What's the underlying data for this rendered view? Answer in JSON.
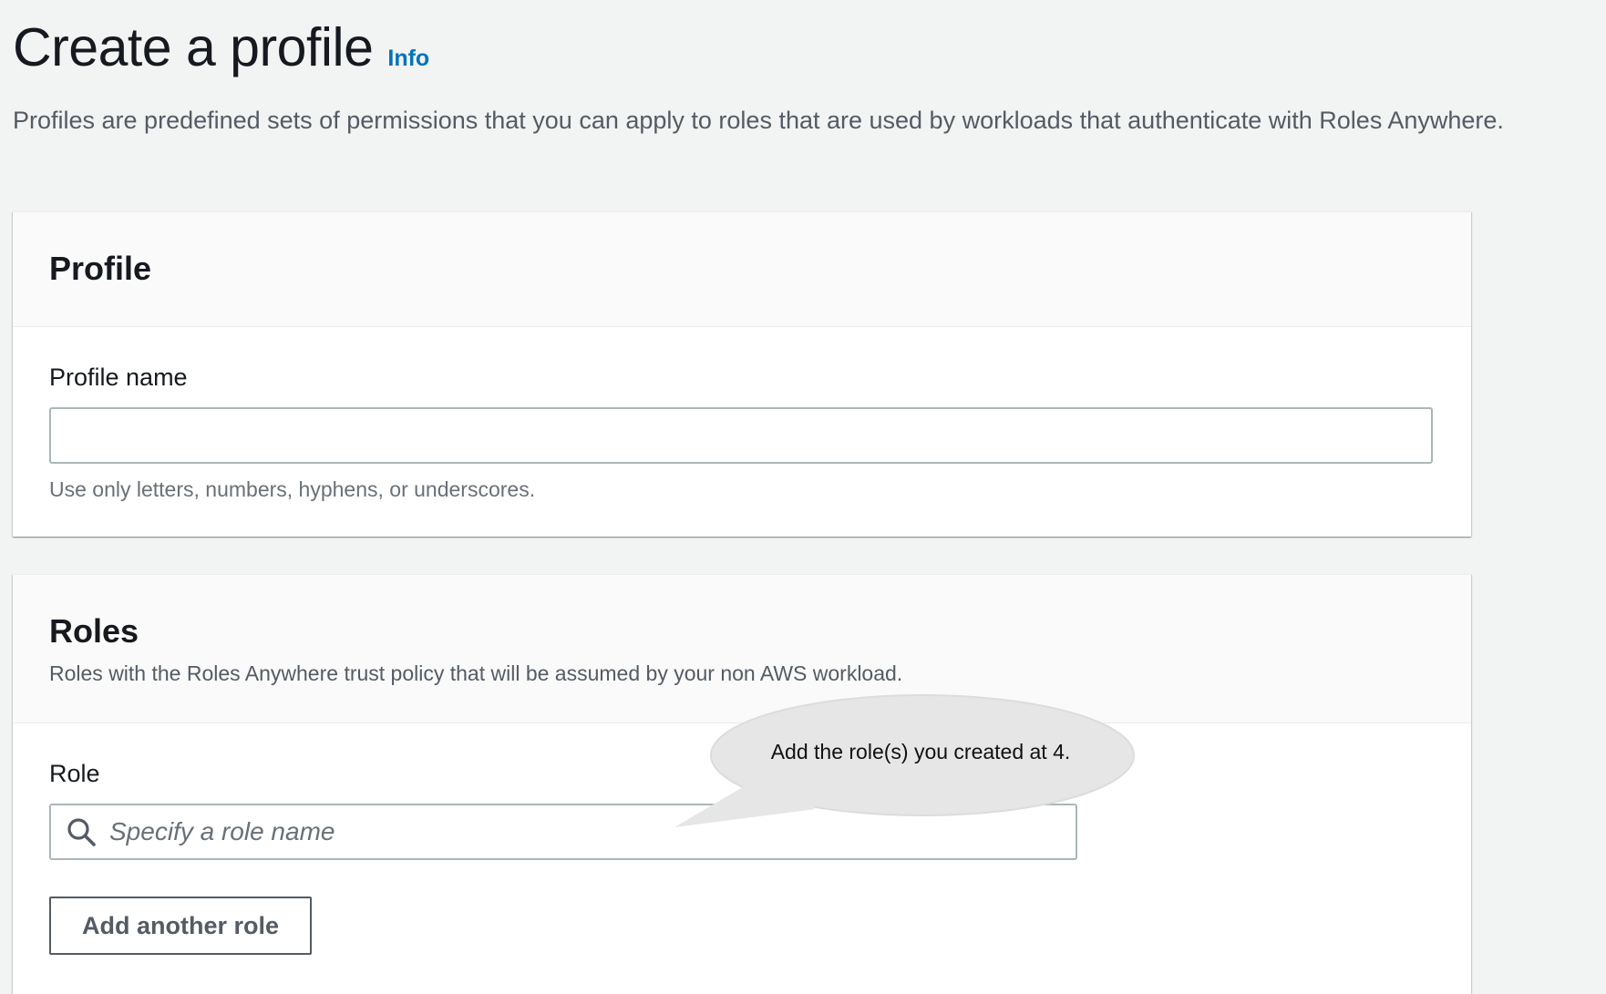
{
  "header": {
    "title": "Create a profile",
    "info_link": "Info",
    "description": "Profiles are predefined sets of permissions that you can apply to roles that are used by workloads that authenticate with Roles Anywhere."
  },
  "profile_panel": {
    "title": "Profile",
    "name_label": "Profile name",
    "name_value": "",
    "name_hint": "Use only letters, numbers, hyphens, or underscores."
  },
  "roles_panel": {
    "title": "Roles",
    "description": "Roles with the Roles Anywhere trust policy that will be assumed by your non AWS workload.",
    "role_label": "Role",
    "role_placeholder": "Specify a role name",
    "add_button": "Add another role"
  },
  "callout": {
    "text": "Add the role(s) you created at 4."
  },
  "icons": {
    "search": "search-icon"
  },
  "colors": {
    "link": "#0073bb",
    "background": "#f2f3f3",
    "callout_fill": "#e6e6e6"
  }
}
